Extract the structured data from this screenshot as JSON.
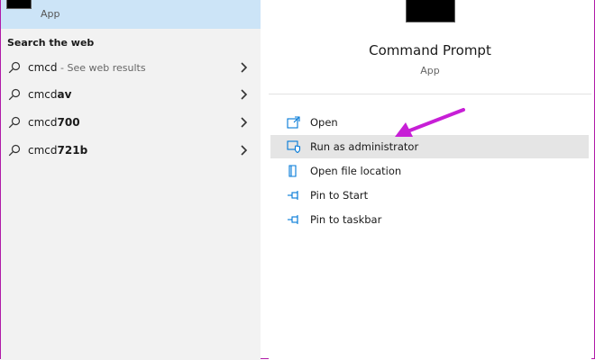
{
  "best_match": {
    "subtitle": "App"
  },
  "web_section": {
    "title": "Search the web"
  },
  "web_results": [
    {
      "prefix": "cmcd",
      "bold": "",
      "hint": " - See web results"
    },
    {
      "prefix": "cmcd",
      "bold": "av",
      "hint": ""
    },
    {
      "prefix": "cmcd",
      "bold": "700",
      "hint": ""
    },
    {
      "prefix": "cmcd",
      "bold": "721b",
      "hint": ""
    }
  ],
  "details": {
    "title": "Command Prompt",
    "type": "App",
    "actions": [
      {
        "label": "Open",
        "icon": "open-icon"
      },
      {
        "label": "Run as administrator",
        "icon": "shield-icon"
      },
      {
        "label": "Open file location",
        "icon": "file-location-icon"
      },
      {
        "label": "Pin to Start",
        "icon": "pin-icon"
      },
      {
        "label": "Pin to taskbar",
        "icon": "pin-icon"
      }
    ]
  },
  "colors": {
    "accent": "#0078d7",
    "highlight": "#cce4f7",
    "annotation_arrow": "#c71fd6"
  }
}
